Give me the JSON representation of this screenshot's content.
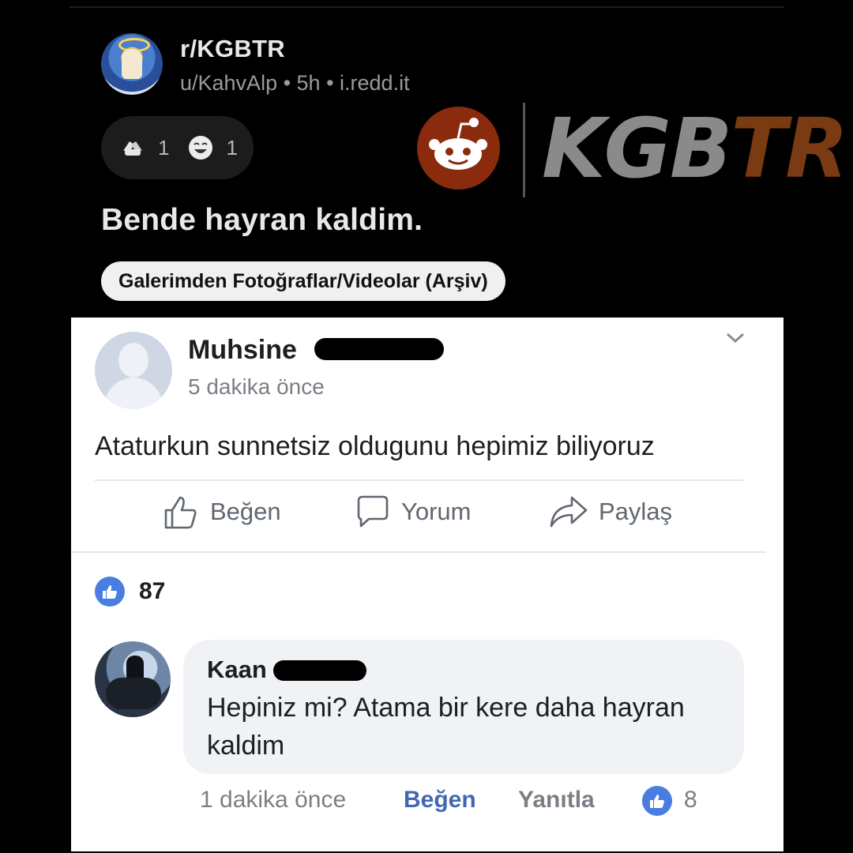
{
  "reddit": {
    "subreddit": "r/KGBTR",
    "meta": "u/KahvAlp • 5h • i.redd.it",
    "awards": [
      {
        "icon": "hands-award-icon",
        "count": "1"
      },
      {
        "icon": "laughing-face-award-icon",
        "count": "1"
      }
    ],
    "title": "Bende hayran kaldim.",
    "flair": "Galerimden Fotoğraflar/Videolar (Arşiv)"
  },
  "logo": {
    "text_a": "KGB",
    "text_b": "TR",
    "colors": {
      "gray": "#8a8a8a",
      "brown": "#7a3a12",
      "circle": "#8a2b0d"
    }
  },
  "facebook_post": {
    "author": "Muhsine",
    "time": "5 dakika önce",
    "text": "Ataturkun sunnetsiz oldugunu hepimiz biliyoruz",
    "actions": {
      "like": "Beğen",
      "comment": "Yorum",
      "share": "Paylaş"
    },
    "like_count": "87",
    "accent": "#4a7de0"
  },
  "comment": {
    "author": "Kaan",
    "text": "Hepiniz mi? Atama bir kere daha hayran kaldim",
    "time": "1 dakika önce",
    "like": "Beğen",
    "reply": "Yanıtla",
    "like_count": "8"
  }
}
